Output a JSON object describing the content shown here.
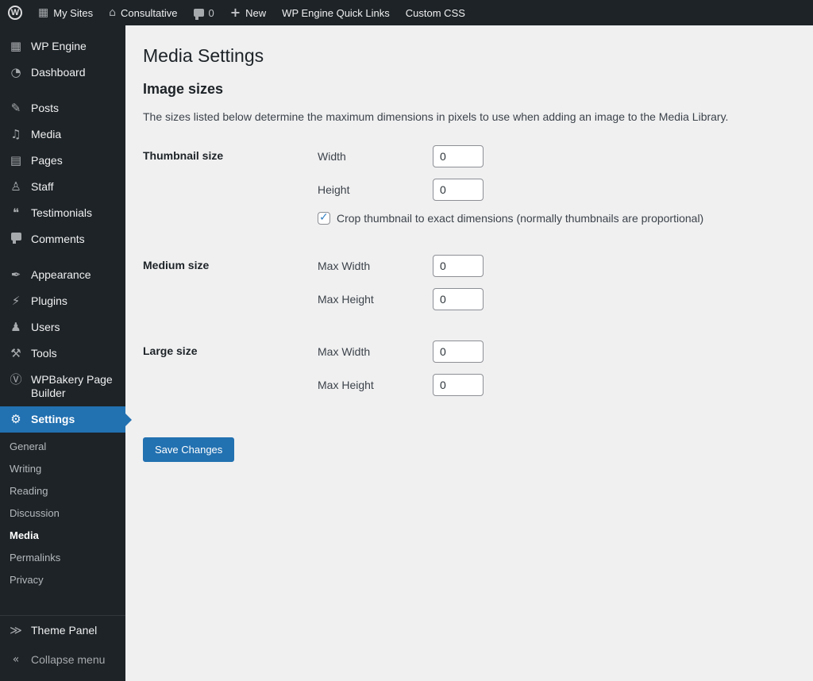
{
  "colors": {
    "accent": "#2271b1",
    "admin_bar_bg": "#1d2327",
    "content_bg": "#f0f0f1",
    "button_bg": "#2271b1"
  },
  "icons": {
    "wp_logo": "W",
    "my_sites": "▦",
    "site_home": "⌂",
    "plus": "+",
    "wpengine": "▦",
    "dashboard": "◔",
    "posts": "✎",
    "media": "♫",
    "pages": "▤",
    "staff": "♙",
    "testimonials": "❝",
    "appearance": "✒",
    "plugins": "⚡",
    "users": "♟",
    "tools": "⚒",
    "wpbakery": "Ⓥ",
    "settings": "⚙",
    "theme_panel": "≫",
    "collapse": "«"
  },
  "admin_bar": {
    "my_sites_label": "My Sites",
    "site_name": "Consultative",
    "comments_count": "0",
    "new_label": "New",
    "quick_links_label": "WP Engine Quick Links",
    "custom_css_label": "Custom CSS"
  },
  "sidebar": {
    "items": [
      {
        "label": "WP Engine"
      },
      {
        "label": "Dashboard"
      },
      {
        "label": "Posts"
      },
      {
        "label": "Media"
      },
      {
        "label": "Pages"
      },
      {
        "label": "Staff"
      },
      {
        "label": "Testimonials"
      },
      {
        "label": "Comments"
      },
      {
        "label": "Appearance"
      },
      {
        "label": "Plugins"
      },
      {
        "label": "Users"
      },
      {
        "label": "Tools"
      },
      {
        "label": "WPBakery Page Builder"
      },
      {
        "label": "Settings"
      }
    ],
    "submenu": [
      "General",
      "Writing",
      "Reading",
      "Discussion",
      "Media",
      "Permalinks",
      "Privacy"
    ],
    "current_submenu": "Media",
    "footer": {
      "theme_panel": "Theme Panel",
      "collapse": "Collapse menu"
    }
  },
  "main": {
    "title": "Media Settings",
    "section_title": "Image sizes",
    "description": "The sizes listed below determine the maximum dimensions in pixels to use when adding an image to the Media Library.",
    "thumbnail": {
      "label": "Thumbnail size",
      "width_label": "Width",
      "width_value": "0",
      "height_label": "Height",
      "height_value": "0",
      "crop_label": "Crop thumbnail to exact dimensions (normally thumbnails are proportional)",
      "crop_checked": true
    },
    "medium": {
      "label": "Medium size",
      "max_width_label": "Max Width",
      "max_width_value": "0",
      "max_height_label": "Max Height",
      "max_height_value": "0"
    },
    "large": {
      "label": "Large size",
      "max_width_label": "Max Width",
      "max_width_value": "0",
      "max_height_label": "Max Height",
      "max_height_value": "0"
    },
    "save_button": "Save Changes"
  }
}
